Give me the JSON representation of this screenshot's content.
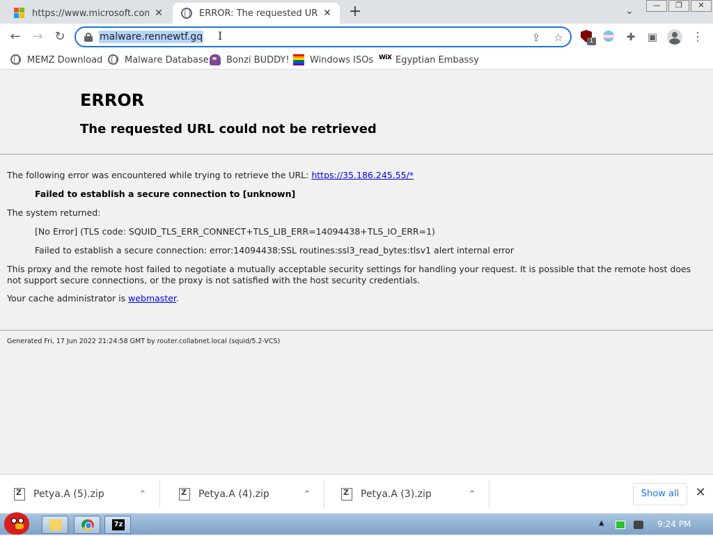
{
  "browser": {
    "tabs": [
      {
        "title": "https://www.microsoft.com/sc",
        "close": "✕"
      },
      {
        "title": "ERROR: The requested URL co",
        "close": "✕"
      }
    ],
    "new_tab": "+",
    "tab_list": "⌄",
    "window_buttons": [
      "—",
      "❐",
      "✕"
    ],
    "nav": {
      "back": "←",
      "forward": "→",
      "reload": "↻"
    },
    "address": {
      "url": "malware.rennewtf.gq",
      "selected": true
    },
    "omnibox_icons": [
      "share-icon",
      "star-icon"
    ],
    "extensions": {
      "ublock_badge": "1"
    },
    "menu": "⋮",
    "toolbar_icons": {
      "share": "⇪",
      "star": "☆",
      "puzzle": "✚",
      "sidepanel": "▣"
    }
  },
  "bookmarks": [
    {
      "label": "MEMZ Download",
      "icon": "globe-icon"
    },
    {
      "label": "Malware Database",
      "icon": "globe-icon"
    },
    {
      "label": "Bonzi BUDDY!",
      "icon": "bonzi-icon"
    },
    {
      "label": "Windows ISOs",
      "icon": "rainbow-flag-icon"
    },
    {
      "label": "Egyptian Embassy",
      "icon": "wix-icon",
      "icon_text": "WiX"
    }
  ],
  "page": {
    "h1": "ERROR",
    "h2": "The requested URL could not be retrieved",
    "intro": "The following error was encountered while trying to retrieve the URL: ",
    "intro_link": "https://35.186.245.55/*",
    "error_bold": "Failed to establish a secure connection to [unknown]",
    "system_returned": "The system returned:",
    "tls_code": "[No Error] (TLS code: SQUID_TLS_ERR_CONNECT+TLS_LIB_ERR=14094438+TLS_IO_ERR=1)",
    "ssl_error": "Failed to establish a secure connection: error:14094438:SSL routines:ssl3_read_bytes:tlsv1 alert internal error",
    "explanation": "This proxy and the remote host failed to negotiate a mutually acceptable security settings for handling your request. It is possible that the remote host does not support secure connections, or the proxy is not satisfied with the host security credentials.",
    "cache_admin_prefix": "Your cache administrator is ",
    "cache_admin_link": "webmaster",
    "cache_admin_suffix": ".",
    "generated": "Generated Fri, 17 Jun 2022 21:24:58 GMT by router.collabnet.local (squid/5.2-VCS)"
  },
  "downloads": {
    "items": [
      {
        "name": "Petya.A (5).zip"
      },
      {
        "name": "Petya.A (4).zip"
      },
      {
        "name": "Petya.A (3).zip"
      }
    ],
    "caret": "⌃",
    "show_all": "Show all",
    "close": "✕"
  },
  "taskbar": {
    "apps": [
      "folder-icon",
      "chrome-icon",
      "7zip-icon"
    ],
    "sevenzip_label": "7z",
    "tray_up": "▲",
    "clock": "9:24 PM"
  },
  "colors": {
    "accent": "#1a73e8",
    "selection": "#b3d4fc",
    "link": "#0000ee",
    "page_bg": "#f1f1f1"
  }
}
